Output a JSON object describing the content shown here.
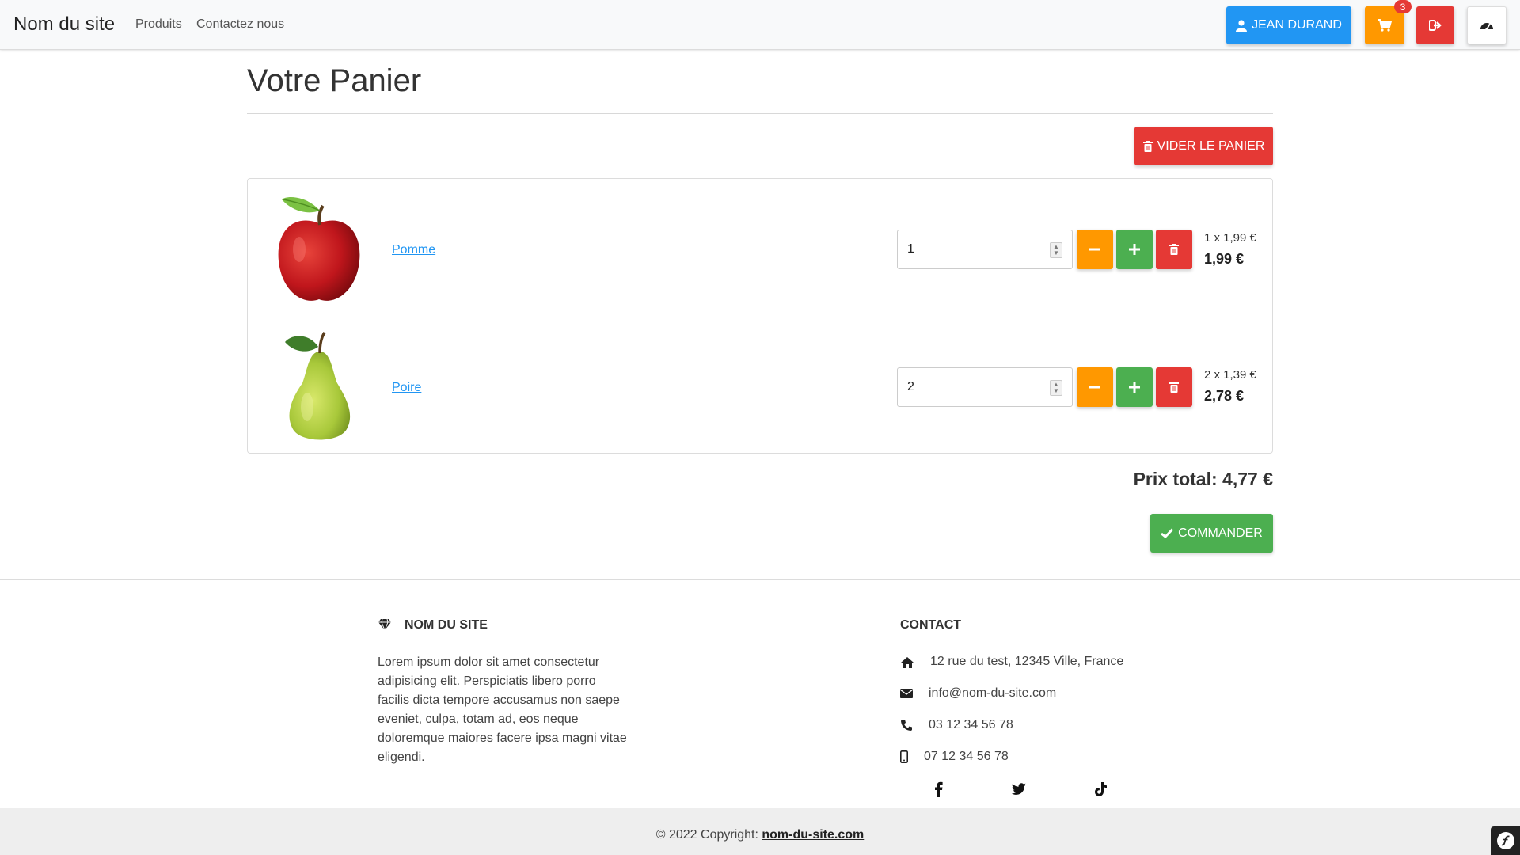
{
  "navbar": {
    "brand": "Nom du site",
    "links": [
      "Produits",
      "Contactez nous"
    ],
    "user_button": "JEAN DURAND",
    "cart_count": "3"
  },
  "main": {
    "title": "Votre Panier",
    "empty_cart_button": "VIDER LE PANIER",
    "items": [
      {
        "name": "Pomme",
        "quantity": "1",
        "unit_price": "1 x 1,99 €",
        "line_total": "1,99 €",
        "image": "apple"
      },
      {
        "name": "Poire",
        "quantity": "2",
        "unit_price": "2 x 1,39 €",
        "line_total": "2,78 €",
        "image": "pear"
      }
    ],
    "total": "Prix total: 4,77 €",
    "order_button": "COMMANDER"
  },
  "footer": {
    "site_heading": "NOM DU SITE",
    "description": "Lorem ipsum dolor sit amet consectetur adipisicing elit. Perspiciatis libero porro facilis dicta tempore accusamus non saepe eveniet, culpa, totam ad, eos neque doloremque maiores facere ipsa magni vitae eligendi.",
    "contact_heading": "CONTACT",
    "address": "12 rue du test, 12345 Ville, France",
    "email": "info@nom-du-site.com",
    "phone": "03 12 34 56 78",
    "mobile": "07 12 34 56 78",
    "social_icons": [
      "facebook-icon",
      "twitter-icon",
      "tiktok-icon"
    ],
    "copyright_prefix": "© 2022 Copyright: ",
    "copyright_link": "nom-du-site.com"
  },
  "colors": {
    "primary": "#2196f3",
    "warning": "#ff9800",
    "danger": "#e53935",
    "success": "#4caf50"
  }
}
